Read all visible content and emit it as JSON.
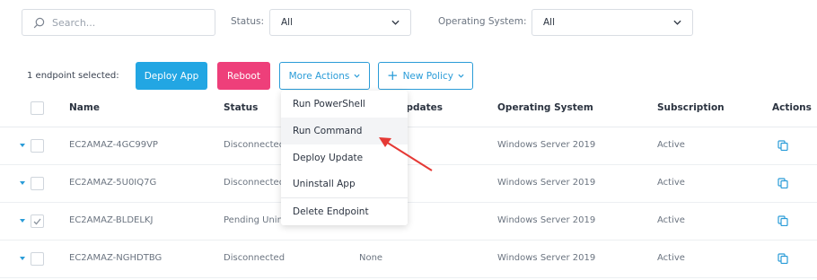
{
  "search": {
    "placeholder": "Search..."
  },
  "filters": {
    "status_label": "Status:",
    "status_value": "All",
    "os_label": "Operating System:",
    "os_value": "All"
  },
  "actions": {
    "selected_text": "1 endpoint selected:",
    "deploy_app": "Deploy App",
    "reboot": "Reboot",
    "more_actions": "More Actions",
    "new_policy": "New Policy"
  },
  "table": {
    "columns": {
      "name": "Name",
      "status": "Status",
      "updates": "Updates",
      "os": "Operating System",
      "subscription": "Subscription",
      "actions": "Actions"
    },
    "rows": [
      {
        "name": "EC2AMAZ-4GC99VP",
        "status": "Disconnected",
        "updates": "",
        "os": "Windows Server 2019",
        "subscription": "Active",
        "checked": false
      },
      {
        "name": "EC2AMAZ-5U0IQ7G",
        "status": "Disconnected",
        "updates": "",
        "os": "Windows Server 2019",
        "subscription": "Active",
        "checked": false
      },
      {
        "name": "EC2AMAZ-BLDELKJ",
        "status": "Pending Uninstall",
        "updates": "",
        "os": "Windows Server 2019",
        "subscription": "Active",
        "checked": true
      },
      {
        "name": "EC2AMAZ-NGHDTBG",
        "status": "Disconnected",
        "updates": "None",
        "os": "Windows Server 2019",
        "subscription": "Active",
        "checked": false
      }
    ]
  },
  "menu": {
    "items": [
      "Run PowerShell",
      "Run Command",
      "Deploy Update",
      "Uninstall App",
      "Delete Endpoint"
    ],
    "highlighted": "Run Command"
  },
  "colors": {
    "accent_blue": "#22a6e3",
    "reboot_pink": "#ee3f7a",
    "annotation_red": "#e53935"
  }
}
